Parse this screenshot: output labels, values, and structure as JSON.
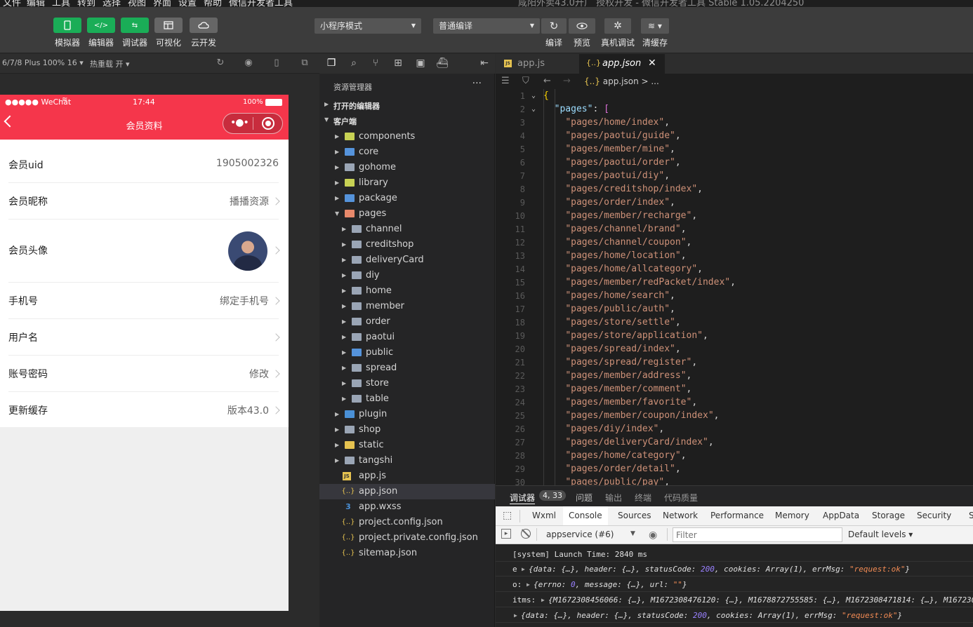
{
  "menubar": {
    "items": [
      "文件",
      "编辑",
      "工具",
      "转到",
      "选择",
      "视图",
      "界面",
      "设置",
      "帮助",
      "微信开发者工具"
    ],
    "title": "咸阳外卖43.0升广 授权开发 - 微信开发者工具 Stable 1.05.2204250"
  },
  "toolbar": {
    "left_buttons": [
      {
        "label": "模拟器",
        "icon": "phone-icon"
      },
      {
        "label": "编辑器",
        "icon": "code-icon"
      },
      {
        "label": "调试器",
        "icon": "debug-icon"
      },
      {
        "label": "可视化",
        "icon": "layout-icon"
      },
      {
        "label": "云开发",
        "icon": "cloud-icon"
      }
    ],
    "mode_select": "小程序模式",
    "compile_select": "普通编译",
    "right_buttons": [
      {
        "label": "编译",
        "icon": "refresh-icon"
      },
      {
        "label": "预览",
        "icon": "eye-icon"
      },
      {
        "label": "真机调试",
        "icon": "bug-icon"
      },
      {
        "label": "清缓存",
        "icon": "layers-icon"
      }
    ]
  },
  "simulator": {
    "device": "6/7/8 Plus 100% 16",
    "hot_reload": "热重载 开",
    "status": {
      "carrier": "●●●●● WeChat",
      "time": "17:44",
      "battery": "100%"
    },
    "nav_title": "会员资料",
    "rows": [
      {
        "label": "会员uid",
        "value": "1905002326",
        "arrow": false
      },
      {
        "label": "会员昵称",
        "value": "播播资源",
        "arrow": true
      },
      {
        "label": "会员头像",
        "value": "",
        "arrow": true,
        "avatar": true
      },
      {
        "label": "手机号",
        "value": "绑定手机号",
        "arrow": true
      },
      {
        "label": "用户名",
        "value": "",
        "arrow": true
      },
      {
        "label": "账号密码",
        "value": "修改",
        "arrow": true
      },
      {
        "label": "更新缓存",
        "value": "版本43.0",
        "arrow": true
      }
    ]
  },
  "explorer": {
    "title": "资源管理器",
    "more": "···",
    "sections": {
      "open_editors": "打开的编辑器",
      "client": "客户端"
    },
    "tree": [
      {
        "name": "components",
        "depth": 1,
        "type": "fold-comp",
        "selected": false
      },
      {
        "name": "core",
        "depth": 1,
        "type": "fold-core",
        "selected": false
      },
      {
        "name": "gohome",
        "depth": 1,
        "type": "folder",
        "selected": false
      },
      {
        "name": "library",
        "depth": 1,
        "type": "fold-lib",
        "selected": false
      },
      {
        "name": "package",
        "depth": 1,
        "type": "fold-pkg",
        "selected": false
      },
      {
        "name": "pages",
        "depth": 1,
        "type": "fold-open",
        "selected": false,
        "open": true
      },
      {
        "name": "channel",
        "depth": 2,
        "type": "folder",
        "selected": false
      },
      {
        "name": "creditshop",
        "depth": 2,
        "type": "folder",
        "selected": false
      },
      {
        "name": "deliveryCard",
        "depth": 2,
        "type": "folder",
        "selected": false
      },
      {
        "name": "diy",
        "depth": 2,
        "type": "folder",
        "selected": false
      },
      {
        "name": "home",
        "depth": 2,
        "type": "folder",
        "selected": false
      },
      {
        "name": "member",
        "depth": 2,
        "type": "folder",
        "selected": false
      },
      {
        "name": "order",
        "depth": 2,
        "type": "folder",
        "selected": false
      },
      {
        "name": "paotui",
        "depth": 2,
        "type": "folder",
        "selected": false
      },
      {
        "name": "public",
        "depth": 2,
        "type": "fold-pub",
        "selected": false
      },
      {
        "name": "spread",
        "depth": 2,
        "type": "folder",
        "selected": false
      },
      {
        "name": "store",
        "depth": 2,
        "type": "folder",
        "selected": false
      },
      {
        "name": "table",
        "depth": 2,
        "type": "folder",
        "selected": false
      },
      {
        "name": "plugin",
        "depth": 1,
        "type": "fold-plugin",
        "selected": false
      },
      {
        "name": "shop",
        "depth": 1,
        "type": "folder",
        "selected": false
      },
      {
        "name": "static",
        "depth": 1,
        "type": "fold-static",
        "selected": false
      },
      {
        "name": "tangshi",
        "depth": 1,
        "type": "folder",
        "selected": false
      },
      {
        "name": "app.js",
        "depth": 0,
        "type": "js",
        "selected": false
      },
      {
        "name": "app.json",
        "depth": 0,
        "type": "json",
        "selected": true
      },
      {
        "name": "app.wxss",
        "depth": 0,
        "type": "css",
        "selected": false
      },
      {
        "name": "project.config.json",
        "depth": 0,
        "type": "json",
        "selected": false
      },
      {
        "name": "project.private.config.json",
        "depth": 0,
        "type": "json",
        "selected": false
      },
      {
        "name": "sitemap.json",
        "depth": 0,
        "type": "json",
        "selected": false
      }
    ]
  },
  "editor": {
    "tabs": [
      {
        "label": "app.js",
        "active": false,
        "icon": "JS"
      },
      {
        "label": "app.json",
        "active": true,
        "icon": "{..}"
      }
    ],
    "breadcrumb": "app.json > ...",
    "pages_key": "\"pages\"",
    "page_lines": [
      "pages/home/index",
      "pages/paotui/guide",
      "pages/member/mine",
      "pages/paotui/order",
      "pages/paotui/diy",
      "pages/creditshop/index",
      "pages/order/index",
      "pages/member/recharge",
      "pages/channel/brand",
      "pages/channel/coupon",
      "pages/home/location",
      "pages/home/allcategory",
      "pages/member/redPacket/index",
      "pages/home/search",
      "pages/public/auth",
      "pages/store/settle",
      "pages/store/application",
      "pages/spread/index",
      "pages/spread/register",
      "pages/member/address",
      "pages/member/comment",
      "pages/member/favorite",
      "pages/member/coupon/index",
      "pages/diy/index",
      "pages/deliveryCard/index",
      "pages/home/category",
      "pages/order/detail",
      "pages/public/pay"
    ]
  },
  "debug": {
    "tabs": [
      {
        "label": "调试器",
        "active": true
      },
      {
        "label": "4, 33",
        "badge": true
      },
      {
        "label": "问题",
        "active": false
      },
      {
        "label": "输出",
        "active": false
      },
      {
        "label": "终端",
        "active": false
      },
      {
        "label": "代码质量",
        "active": false
      }
    ],
    "devtools_tabs": [
      "Wxml",
      "Console",
      "Sources",
      "Network",
      "Performance",
      "Memory",
      "AppData",
      "Storage",
      "Security",
      "S"
    ],
    "active_devtools_tab": "Console",
    "context": "appservice (#6)",
    "filter_placeholder": "Filter",
    "levels": "Default levels",
    "console_lines": [
      {
        "prefix": "",
        "text": "[system] Launch Time: 2840 ms"
      },
      {
        "prefix": "e",
        "text": "{data: {…}, header: {…}, statusCode: 200, cookies: Array(1), errMsg: \"request:ok\"}"
      },
      {
        "prefix": "o:",
        "text": "{errno: 0, message: {…}, url: \"\"}"
      },
      {
        "prefix": "itms:",
        "text": "{M1672308456066: {…}, M1672308476120: {…}, M1678872755585: {…}, M1672308471814: {…}, M1672308…"
      },
      {
        "prefix": "",
        "text": "{data: {…}, header: {…}, statusCode: 200, cookies: Array(1), errMsg: \"request:ok\"}"
      }
    ]
  },
  "colors": {
    "accent_green": "#1aad57",
    "nav_red": "#f5364b",
    "string_orange": "#ce9178",
    "key_blue": "#9cdcfe"
  }
}
